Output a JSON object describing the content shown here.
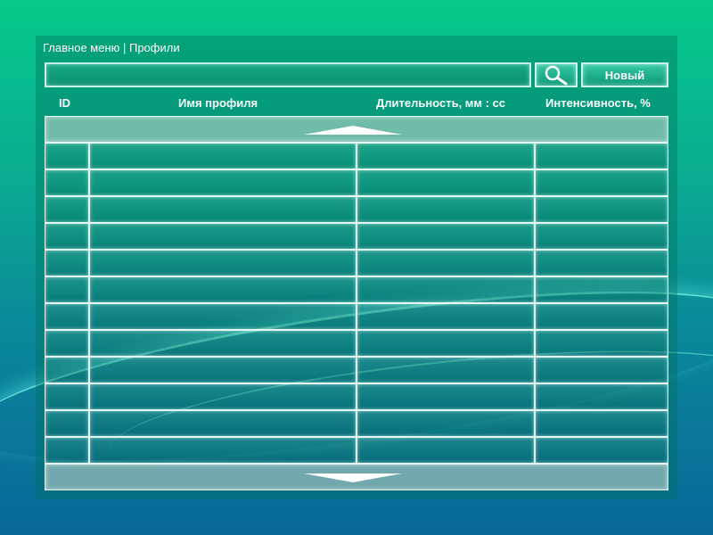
{
  "header": {
    "breadcrumb": "Главное меню | Профили"
  },
  "toolbar": {
    "search_value": "",
    "search_placeholder": "",
    "search_icon": "search-icon",
    "new_label": "Новый"
  },
  "table": {
    "columns": [
      "ID",
      "Имя профиля",
      "Длительность, мм : сс",
      "Интенсивность, %"
    ],
    "rows": [
      [
        "",
        "",
        "",
        ""
      ],
      [
        "",
        "",
        "",
        ""
      ],
      [
        "",
        "",
        "",
        ""
      ],
      [
        "",
        "",
        "",
        ""
      ],
      [
        "",
        "",
        "",
        ""
      ],
      [
        "",
        "",
        "",
        ""
      ],
      [
        "",
        "",
        "",
        ""
      ],
      [
        "",
        "",
        "",
        ""
      ],
      [
        "",
        "",
        "",
        ""
      ],
      [
        "",
        "",
        "",
        ""
      ],
      [
        "",
        "",
        "",
        ""
      ],
      [
        "",
        "",
        "",
        ""
      ]
    ]
  },
  "colors": {
    "background_top": "#05c98a",
    "background_bottom": "#08679a",
    "text": "#ffffff"
  }
}
